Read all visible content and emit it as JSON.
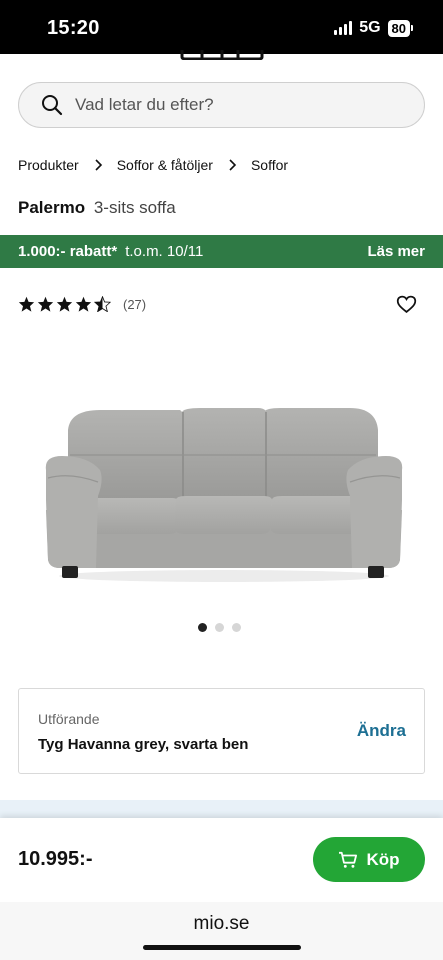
{
  "status_bar": {
    "time": "15:20",
    "network": "5G",
    "battery": "80",
    "signal_icon": "signal-bars-icon",
    "battery_icon": "battery-icon"
  },
  "search": {
    "placeholder": "Vad letar du efter?",
    "icon": "search-icon"
  },
  "breadcrumb": {
    "items": [
      "Produkter",
      "Soffor & fåtöljer",
      "Soffor"
    ],
    "separator_icon": "chevron-right-icon"
  },
  "product": {
    "name": "Palermo",
    "subtitle": "3-sits soffa"
  },
  "promo": {
    "discount": "1.000:- rabatt*",
    "date": "t.o.m. 10/11",
    "link": "Läs mer",
    "color": "#2f7a45"
  },
  "rating": {
    "stars": 4.5,
    "max": 5,
    "count": "(27)",
    "favorite_icon": "heart-icon"
  },
  "gallery": {
    "image": "sofa-image",
    "dots": 3,
    "active_dot": 1
  },
  "variant": {
    "label": "Utförande",
    "value": "Tyg Havanna grey, svarta ben",
    "change": "Ändra",
    "accent": "#1d6f93"
  },
  "bottom_bar": {
    "price": "10.995:-",
    "buy_label": "Köp",
    "buy_icon": "cart-icon",
    "buy_color": "#23a636"
  },
  "browser": {
    "address": "mio.se"
  }
}
